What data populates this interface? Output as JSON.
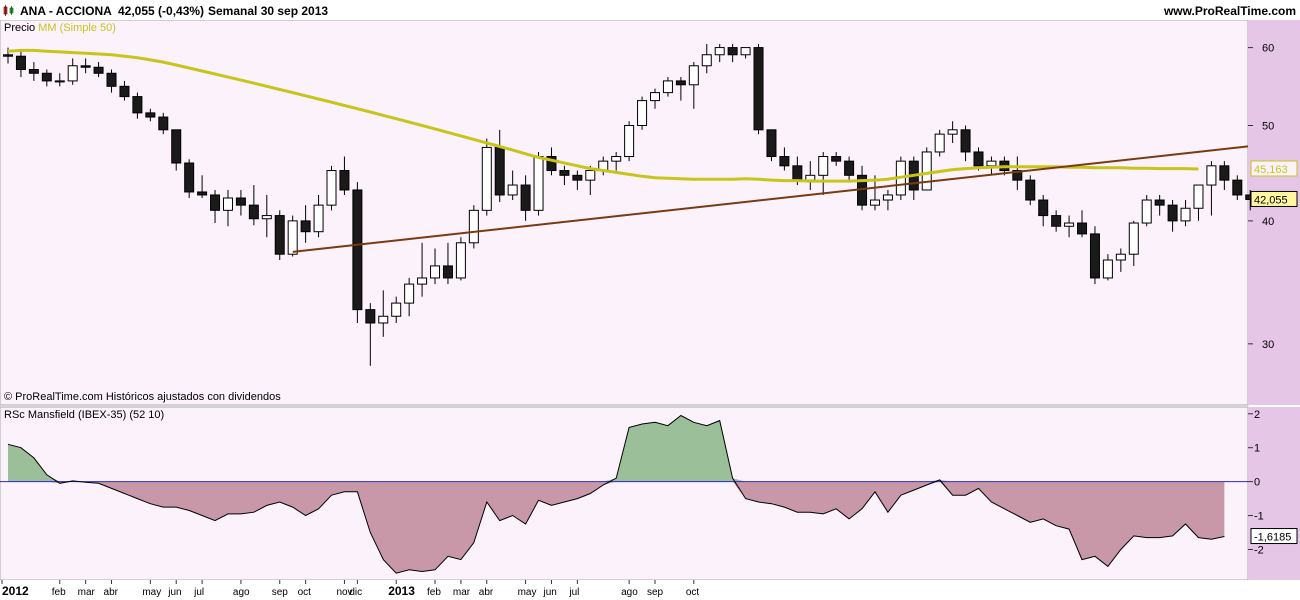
{
  "header": {
    "ticker": "ANA - ACCIONA",
    "price_change": "42,055 (-0,43%)",
    "period": "Semanal  30 sep 2013",
    "site": "www.ProRealTime.com"
  },
  "price_panel": {
    "label_price": "Precio",
    "label_ma": "MM (Simple 50)",
    "copyright": "© ProRealTime.com  Históricos ajustados con dividendos",
    "ma_value_label": "45,163",
    "last_value_label": "42,055"
  },
  "rs_panel": {
    "label": "RSc Mansfield (IBEX-35) (52 10)",
    "last_value_label": "-1,6185"
  },
  "colors": {
    "price_bg": "#fbf2fb",
    "axis_bg": "#e6c6e6",
    "ma_line": "#c8c41a",
    "trend_line": "#7a3a10",
    "rs_pos_fill": "#9bbf98",
    "rs_neg_fill": "#c898a8",
    "rs_zero_line": "#2b2bd0"
  },
  "chart_data": [
    {
      "type": "candlestick",
      "title": "ANA - ACCIONA",
      "y_ticks": [
        60,
        50,
        40,
        30
      ],
      "ylim": [
        26,
        64
      ],
      "y_scale": "log",
      "x_labels": [
        "2012",
        "feb",
        "mar",
        "abr",
        "may",
        "jun",
        "jul",
        "ago",
        "sep",
        "oct",
        "nov",
        "dic",
        "2013",
        "feb",
        "mar",
        "abr",
        "may",
        "jun",
        "jul",
        "ago",
        "sep",
        "oct"
      ],
      "series": [
        {
          "name": "Precio",
          "ohlc": [
            [
              59.0,
              60.0,
              57.8,
              58.8
            ],
            [
              58.8,
              59.8,
              56.0,
              57.0
            ],
            [
              57.0,
              58.0,
              55.5,
              56.5
            ],
            [
              56.5,
              57.0,
              54.8,
              55.5
            ],
            [
              55.5,
              56.5,
              54.8,
              55.5
            ],
            [
              55.5,
              58.5,
              55.0,
              57.5
            ],
            [
              57.5,
              58.5,
              56.5,
              57.3
            ],
            [
              57.3,
              58.0,
              56.0,
              56.5
            ],
            [
              56.5,
              57.0,
              54.0,
              54.8
            ],
            [
              54.8,
              55.5,
              53.0,
              53.5
            ],
            [
              53.5,
              54.0,
              50.8,
              51.5
            ],
            [
              51.5,
              52.0,
              50.5,
              51.0
            ],
            [
              51.0,
              51.5,
              49.0,
              49.5
            ],
            [
              49.5,
              49.5,
              45.0,
              45.8
            ],
            [
              45.8,
              46.2,
              42.2,
              42.8
            ],
            [
              42.8,
              44.5,
              42.2,
              42.5
            ],
            [
              42.5,
              43.0,
              39.8,
              41.0
            ],
            [
              41.0,
              43.0,
              39.5,
              42.2
            ],
            [
              42.2,
              43.0,
              40.5,
              41.5
            ],
            [
              41.5,
              43.5,
              39.6,
              40.2
            ],
            [
              40.2,
              42.5,
              38.5,
              40.5
            ],
            [
              40.5,
              41.0,
              36.5,
              37.0
            ],
            [
              37.0,
              40.5,
              36.8,
              40.0
            ],
            [
              40.0,
              41.5,
              38.0,
              39.0
            ],
            [
              39.0,
              42.5,
              38.5,
              41.5
            ],
            [
              41.5,
              45.5,
              41.0,
              45.0
            ],
            [
              45.0,
              46.5,
              42.5,
              43.0
            ],
            [
              43.0,
              43.8,
              31.5,
              32.5
            ],
            [
              32.5,
              33.0,
              28.5,
              31.5
            ],
            [
              31.5,
              34.0,
              30.5,
              32.0
            ],
            [
              32.0,
              33.5,
              31.5,
              33.0
            ],
            [
              33.0,
              35.0,
              32.0,
              34.5
            ],
            [
              34.5,
              38.0,
              33.5,
              35.0
            ],
            [
              35.0,
              37.5,
              34.5,
              36.0
            ],
            [
              36.0,
              38.0,
              34.5,
              35.0
            ],
            [
              35.0,
              38.5,
              34.8,
              38.0
            ],
            [
              38.0,
              41.5,
              37.5,
              41.0
            ],
            [
              41.0,
              48.5,
              40.5,
              47.5
            ],
            [
              47.5,
              49.5,
              41.8,
              42.5
            ],
            [
              42.5,
              45.0,
              42.0,
              43.5
            ],
            [
              43.5,
              44.5,
              40.0,
              41.0
            ],
            [
              41.0,
              47.0,
              40.5,
              46.5
            ],
            [
              46.5,
              47.5,
              44.5,
              45.0
            ],
            [
              45.0,
              45.5,
              43.5,
              44.5
            ],
            [
              44.5,
              45.0,
              43.0,
              44.0
            ],
            [
              44.0,
              45.5,
              42.5,
              45.0
            ],
            [
              45.0,
              46.5,
              44.5,
              46.0
            ],
            [
              46.0,
              47.0,
              45.0,
              46.5
            ],
            [
              46.5,
              50.5,
              46.0,
              50.0
            ],
            [
              50.0,
              53.5,
              49.5,
              53.0
            ],
            [
              53.0,
              54.5,
              52.0,
              54.0
            ],
            [
              54.0,
              56.0,
              53.5,
              55.5
            ],
            [
              55.5,
              56.0,
              53.0,
              55.0
            ],
            [
              55.0,
              58.0,
              52.0,
              57.5
            ],
            [
              57.5,
              60.5,
              56.5,
              59.0
            ],
            [
              59.0,
              60.5,
              58.0,
              60.0
            ],
            [
              60.0,
              60.5,
              58.0,
              59.0
            ],
            [
              59.0,
              60.0,
              58.5,
              60.0
            ],
            [
              60.0,
              60.5,
              49.0,
              49.5
            ],
            [
              49.5,
              49.5,
              46.0,
              46.5
            ],
            [
              46.5,
              47.5,
              45.0,
              45.5
            ],
            [
              45.5,
              46.5,
              43.5,
              44.0
            ],
            [
              44.0,
              46.0,
              43.0,
              44.5
            ],
            [
              44.5,
              47.0,
              42.5,
              46.5
            ],
            [
              46.5,
              47.0,
              45.5,
              46.0
            ],
            [
              46.0,
              46.5,
              44.0,
              44.5
            ],
            [
              44.5,
              45.5,
              41.0,
              41.5
            ],
            [
              41.5,
              44.5,
              41.0,
              42.0
            ],
            [
              42.0,
              43.0,
              41.0,
              42.5
            ],
            [
              42.5,
              46.5,
              42.0,
              46.0
            ],
            [
              46.0,
              46.5,
              42.0,
              43.0
            ],
            [
              43.0,
              47.5,
              43.0,
              47.0
            ],
            [
              47.0,
              49.5,
              46.5,
              49.0
            ],
            [
              49.0,
              50.5,
              48.0,
              49.5
            ],
            [
              49.5,
              50.0,
              46.0,
              47.0
            ],
            [
              47.0,
              47.5,
              45.0,
              45.5
            ],
            [
              45.5,
              46.5,
              44.5,
              46.0
            ],
            [
              46.0,
              46.5,
              44.5,
              45.0
            ],
            [
              45.0,
              46.5,
              43.0,
              44.0
            ],
            [
              44.0,
              44.5,
              41.5,
              42.0
            ],
            [
              42.0,
              42.5,
              39.5,
              40.5
            ],
            [
              40.5,
              41.0,
              39.0,
              39.5
            ],
            [
              39.5,
              40.5,
              38.5,
              39.8
            ],
            [
              39.8,
              41.0,
              38.5,
              38.8
            ],
            [
              38.8,
              39.5,
              34.5,
              35.0
            ],
            [
              35.0,
              37.0,
              34.8,
              36.5
            ],
            [
              36.5,
              37.5,
              35.5,
              37.0
            ],
            [
              37.0,
              40.0,
              36.0,
              39.8
            ],
            [
              39.8,
              42.5,
              39.5,
              42.0
            ],
            [
              42.0,
              42.5,
              40.5,
              41.5
            ],
            [
              41.5,
              42.0,
              39.0,
              40.0
            ],
            [
              40.0,
              42.0,
              39.5,
              41.2
            ],
            [
              41.2,
              42.5,
              40.0,
              43.5
            ],
            [
              43.5,
              46.0,
              40.5,
              45.5
            ],
            [
              45.5,
              46.0,
              43.0,
              44.0
            ],
            [
              44.0,
              44.5,
              42.0,
              42.5
            ],
            [
              42.5,
              43.0,
              41.0,
              42.055
            ]
          ]
        },
        {
          "name": "MM (Simple 50)",
          "values": [
            59.5,
            59.6,
            59.6,
            59.5,
            59.4,
            59.3,
            59.2,
            59.1,
            59.0,
            58.8,
            58.6,
            58.3,
            58.0,
            57.6,
            57.2,
            56.8,
            56.4,
            56.0,
            55.6,
            55.2,
            54.8,
            54.4,
            54.0,
            53.6,
            53.2,
            52.8,
            52.4,
            52.0,
            51.6,
            51.2,
            50.8,
            50.4,
            50.0,
            49.6,
            49.2,
            48.8,
            48.4,
            48.0,
            47.6,
            47.2,
            46.8,
            46.4,
            46.1,
            45.8,
            45.5,
            45.2,
            45.0,
            44.8,
            44.6,
            44.4,
            44.25,
            44.2,
            44.15,
            44.1,
            44.1,
            44.1,
            44.1,
            44.15,
            44.1,
            44.0,
            43.95,
            43.95,
            43.9,
            43.9,
            43.9,
            43.9,
            43.95,
            44.0,
            44.1,
            44.3,
            44.5,
            44.7,
            44.9,
            45.1,
            45.2,
            45.3,
            45.35,
            45.4,
            45.4,
            45.4,
            45.4,
            45.4,
            45.35,
            45.35,
            45.3,
            45.3,
            45.3,
            45.25,
            45.25,
            45.2,
            45.2,
            45.2,
            45.163
          ]
        },
        {
          "name": "trend",
          "points": [
            [
              22,
              37.2
            ],
            [
              97,
              47.8
            ]
          ]
        }
      ]
    },
    {
      "type": "area",
      "title": "RSc Mansfield (IBEX-35) (52 10)",
      "y_ticks": [
        2,
        1,
        0,
        -1,
        -2
      ],
      "ylim": [
        -2.9,
        2.2
      ],
      "series": [
        {
          "name": "RSc Mansfield",
          "values": [
            1.1,
            1.0,
            0.7,
            0.2,
            -0.05,
            0.02,
            -0.02,
            -0.05,
            -0.2,
            -0.35,
            -0.5,
            -0.65,
            -0.75,
            -0.75,
            -0.85,
            -1.0,
            -1.15,
            -0.95,
            -0.95,
            -0.9,
            -0.7,
            -0.6,
            -0.75,
            -1.0,
            -0.8,
            -0.4,
            -0.3,
            -0.3,
            -1.5,
            -2.3,
            -2.7,
            -2.6,
            -2.65,
            -2.6,
            -2.2,
            -2.3,
            -1.8,
            -0.6,
            -1.15,
            -1.0,
            -1.25,
            -0.55,
            -0.7,
            -0.6,
            -0.5,
            -0.35,
            -0.1,
            0.1,
            1.6,
            1.7,
            1.75,
            1.65,
            1.95,
            1.75,
            1.65,
            1.8,
            0.1,
            -0.5,
            -0.6,
            -0.65,
            -0.75,
            -0.9,
            -0.9,
            -0.95,
            -0.8,
            -1.1,
            -0.8,
            -0.3,
            -0.9,
            -0.4,
            -0.25,
            -0.1,
            0.05,
            -0.4,
            -0.4,
            -0.2,
            -0.6,
            -0.8,
            -1.0,
            -1.2,
            -1.1,
            -1.3,
            -1.4,
            -2.3,
            -2.2,
            -2.5,
            -2.0,
            -1.6,
            -1.65,
            -1.65,
            -1.6,
            -1.25,
            -1.65,
            -1.7,
            -1.6185
          ]
        }
      ]
    }
  ]
}
